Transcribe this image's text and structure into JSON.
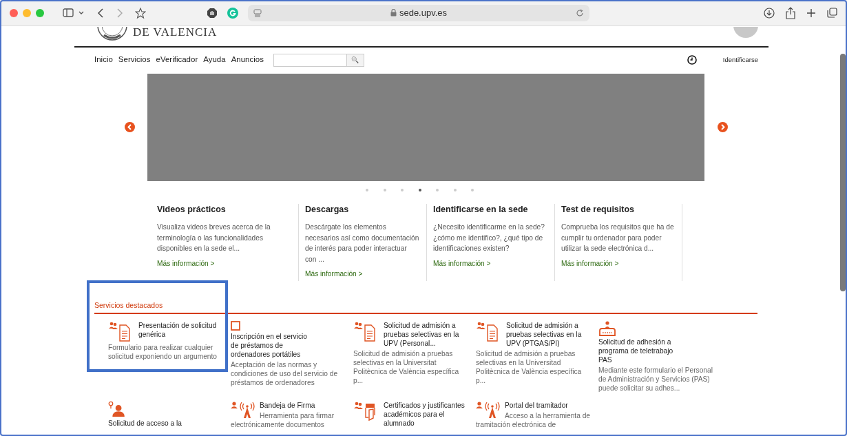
{
  "browser": {
    "address": "sede.upv.es"
  },
  "header": {
    "logo_text": "DE VALENCIA"
  },
  "nav": {
    "items": [
      "Inicio",
      "Servicios",
      "eVerificador",
      "Ayuda",
      "Anuncios"
    ],
    "search_button": "🔍",
    "login": "Identificarse"
  },
  "carousel": {
    "dots": [
      {
        "selected": false
      },
      {
        "selected": false
      },
      {
        "selected": false
      },
      {
        "selected": true
      },
      {
        "selected": false
      },
      {
        "selected": false
      },
      {
        "selected": false
      }
    ]
  },
  "info_columns": [
    {
      "title": "Videos prácticos",
      "text": "Visualiza videos breves acerca de la terminología o las funcionalidades disponibles en la sede el...",
      "link": "Más información >"
    },
    {
      "title": "Descargas",
      "text": "Descárgate los elementos necesarios así como documentación de interés para poder interactuar con ...",
      "link": "Más información >"
    },
    {
      "title": "Identificarse en la sede",
      "text": "¿Necesito identificarme en la sede? ¿cómo me identifico?, ¿qué tipo de identificaciones existen?",
      "link": "Más información >"
    },
    {
      "title": "Test de requisitos",
      "text": "Comprueba los requisitos que ha de cumplir tu ordenador para poder utilizar la sede electrónica d...",
      "link": "Más información >"
    }
  ],
  "services": {
    "title": "Servicios destacados",
    "highlight_box": true,
    "items": [
      {
        "kind": "people-document",
        "title": "Presentación de solicitud\ngenérica",
        "description": "Formulario para realizar cualquier\nsolicitud exponiendo un argumento"
      },
      {
        "kind": "square",
        "title": "Inscripción en el servicio\nde préstamos de\nordenadores portátiles",
        "description": "Aceptación de las normas y\ncondiciones de uso del servicio de\npréstamos de ordenadores"
      },
      {
        "kind": "people-document",
        "title": "Solicitud de admisión a\npruebas selectivas en la\nUPV (Personal...",
        "description": "Solicitud de admisión a pruebas\nselectivas en la Universitat\nPolitècnica de València específica\np..."
      },
      {
        "kind": "people-document",
        "title": "Solicitud de admisión a\npruebas selectivas en la\nUPV (PTGAS/PI)",
        "description": "Solicitud de admisión a pruebas\nselectivas en la Universitad\nPolitècnica de València específica\np..."
      },
      {
        "kind": "telework",
        "title": "Solicitud de adhesión a\nprograma de teletrabajo\nPAS",
        "description": "Mediante este formulario el Personal\nde Administración y Servicios (PAS)\npuede solicitar su adhes..."
      },
      {
        "kind": "location-person",
        "title": "Solicitud de acceso a la"
      },
      {
        "kind": "person-antenna",
        "title": "Bandeja de Firma",
        "description": "Herramienta para firmar\nelectrónicamente documentos"
      },
      {
        "kind": "people-certificate",
        "title": "Certificados y justificantes\nacadémicos para el\nalumnado"
      },
      {
        "kind": "person-antenna",
        "title": "Portal del tramitador",
        "description": "Acceso a la herramienta de\ntramitación electrónica de"
      }
    ]
  }
}
